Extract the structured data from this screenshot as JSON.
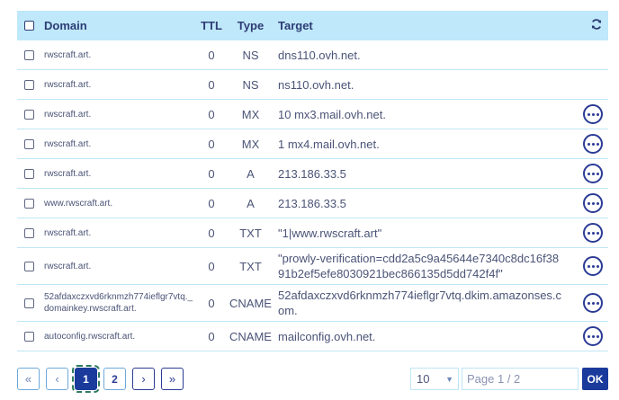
{
  "table": {
    "headers": {
      "domain": "Domain",
      "ttl": "TTL",
      "type": "Type",
      "target": "Target"
    },
    "rows": [
      {
        "domain": "rwscraft.art.",
        "ttl": "0",
        "type": "NS",
        "target": "dns110.ovh.net.",
        "has_actions": false
      },
      {
        "domain": "rwscraft.art.",
        "ttl": "0",
        "type": "NS",
        "target": "ns110.ovh.net.",
        "has_actions": false
      },
      {
        "domain": "rwscraft.art.",
        "ttl": "0",
        "type": "MX",
        "target": "10 mx3.mail.ovh.net.",
        "has_actions": true
      },
      {
        "domain": "rwscraft.art.",
        "ttl": "0",
        "type": "MX",
        "target": "1 mx4.mail.ovh.net.",
        "has_actions": true
      },
      {
        "domain": "rwscraft.art.",
        "ttl": "0",
        "type": "A",
        "target": "213.186.33.5",
        "has_actions": true
      },
      {
        "domain": "www.rwscraft.art.",
        "ttl": "0",
        "type": "A",
        "target": "213.186.33.5",
        "has_actions": true
      },
      {
        "domain": "rwscraft.art.",
        "ttl": "0",
        "type": "TXT",
        "target": "\"1|www.rwscraft.art\"",
        "has_actions": true
      },
      {
        "domain": "rwscraft.art.",
        "ttl": "0",
        "type": "TXT",
        "target": "\"prowly-verification=cdd2a5c9a45644e7340c8dc16f3891b2ef5efe8030921bec866135d5dd742f4f\"",
        "has_actions": true
      },
      {
        "domain": "52afdaxczxvd6rknmzh774ieflgr7vtq._domainkey.rwscraft.art.",
        "ttl": "0",
        "type": "CNAME",
        "target": "52afdaxczxvd6rknmzh774ieflgr7vtq.dkim.amazonses.com.",
        "has_actions": true
      },
      {
        "domain": "autoconfig.rwscraft.art.",
        "ttl": "0",
        "type": "CNAME",
        "target": "mailconfig.ovh.net.",
        "has_actions": true
      }
    ]
  },
  "pagination": {
    "first": "«",
    "prev": "‹",
    "pages": [
      "1",
      "2"
    ],
    "current_page": "1",
    "next": "›",
    "last": "»",
    "per_page": "10",
    "page_input_placeholder": "Page 1 / 2",
    "ok_label": "OK"
  },
  "icons": {
    "refresh": "refresh-icon",
    "more": "more-options-icon"
  },
  "colors": {
    "header_bg": "#bfe8fa",
    "accent": "#1a3a9c",
    "row_border": "#bfe6f6",
    "text": "#4b5477"
  }
}
